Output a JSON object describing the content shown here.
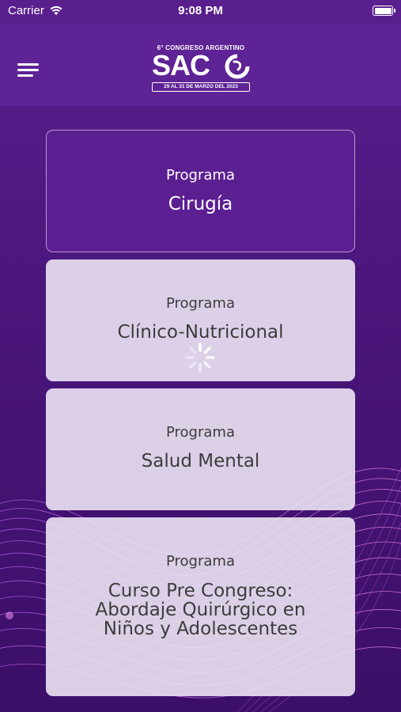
{
  "status_bar": {
    "carrier": "Carrier",
    "time": "9:08 PM"
  },
  "header": {
    "menu_icon": "hamburger-menu-icon",
    "logo": {
      "superscript": "6° CONGRESO ARGENTINO",
      "name": "SAC",
      "dates": "29 AL 31 DE MARZO DEL 2023"
    }
  },
  "programs": [
    {
      "kicker": "Programa",
      "title": "Cirugía",
      "selected": true
    },
    {
      "kicker": "Programa",
      "title": "Clínico-Nutricional",
      "selected": false
    },
    {
      "kicker": "Programa",
      "title": "Salud Mental",
      "selected": false
    },
    {
      "kicker": "Programa",
      "title": "Curso Pre Congreso: Abordaje Quirúrgico en Niños y Adolescentes",
      "selected": false
    }
  ],
  "colors": {
    "background": "#4b167c",
    "header": "#5e2395",
    "selected_card": "#5c1f92",
    "card": "#ece4f4",
    "card_text": "#3c3c3c"
  },
  "loading_indicator": "activity-spinner-icon"
}
